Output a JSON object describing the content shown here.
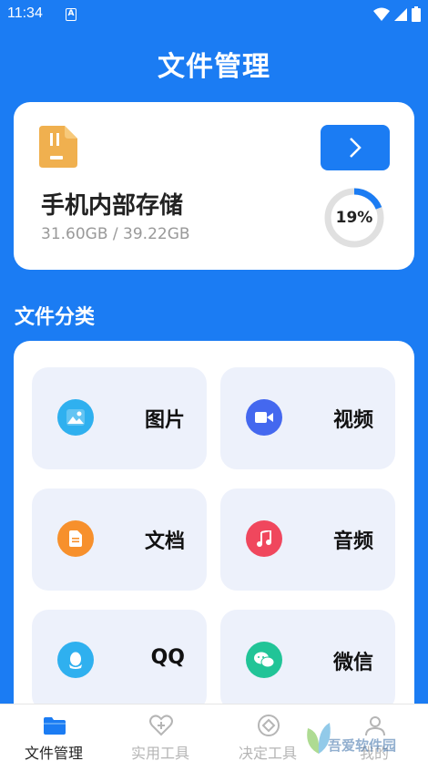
{
  "status_bar": {
    "time": "11:34",
    "indicator": "A"
  },
  "header": {
    "title": "文件管理"
  },
  "storage": {
    "name": "手机内部存储",
    "size_text": "31.60GB / 39.22GB",
    "percent_text": "19%",
    "percent": 19,
    "accent_color": "#1b7cf3"
  },
  "categories": {
    "title": "文件分类",
    "items": [
      {
        "label": "图片",
        "icon": "image-icon",
        "color": "#2fb0ef"
      },
      {
        "label": "视频",
        "icon": "video-icon",
        "color": "#4468ef"
      },
      {
        "label": "文档",
        "icon": "document-icon",
        "color": "#f7902c"
      },
      {
        "label": "音频",
        "icon": "music-icon",
        "color": "#f0475d"
      },
      {
        "label": "QQ",
        "icon": "qq-icon",
        "color": "#2fb0ef"
      },
      {
        "label": "微信",
        "icon": "wechat-icon",
        "color": "#21c497"
      }
    ]
  },
  "tabbar": {
    "tabs": [
      {
        "label": "文件管理",
        "icon": "folder-icon"
      },
      {
        "label": "实用工具",
        "icon": "heart-plus-icon"
      },
      {
        "label": "决定工具",
        "icon": "compass-icon"
      },
      {
        "label": "我的",
        "icon": "user-icon"
      }
    ]
  },
  "watermark": {
    "text": "吾爱软件园",
    "url": "www.52zixue.com"
  }
}
